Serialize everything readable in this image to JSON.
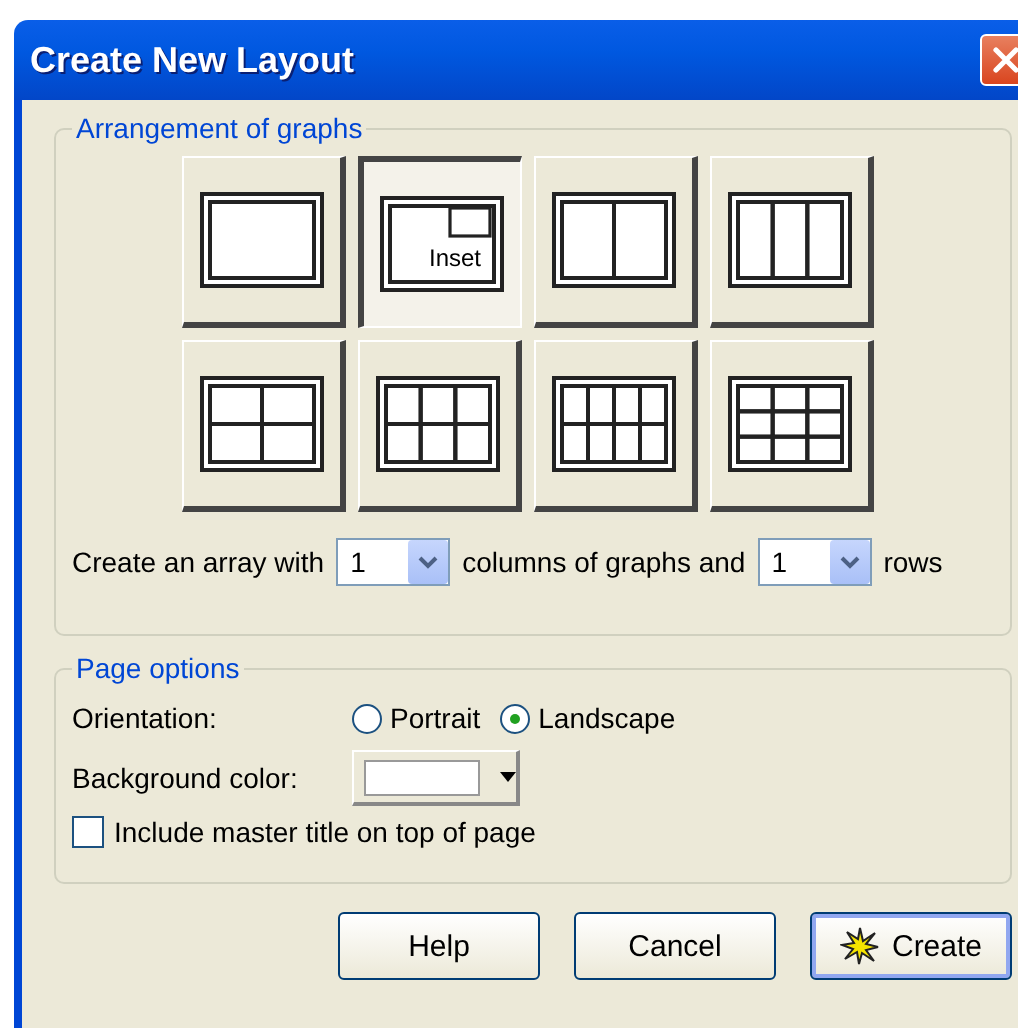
{
  "window": {
    "title": "Create New Layout"
  },
  "arrangement": {
    "legend": "Arrangement of graphs",
    "layouts": [
      {
        "kind": "one",
        "selected": false
      },
      {
        "kind": "inset",
        "label": "Inset",
        "selected": true
      },
      {
        "kind": "two-columns",
        "selected": false
      },
      {
        "kind": "three-columns",
        "selected": false
      },
      {
        "kind": "two-by-two",
        "selected": false
      },
      {
        "kind": "three-by-two",
        "selected": false
      },
      {
        "kind": "four-by-two",
        "selected": false
      },
      {
        "kind": "three-by-three",
        "selected": false
      }
    ],
    "array_row": {
      "prefix": "Create an array with",
      "columns_value": "1",
      "middle": "columns of graphs and",
      "rows_value": "1",
      "suffix": "rows"
    }
  },
  "page_options": {
    "legend": "Page options",
    "orientation": {
      "label": "Orientation:",
      "options": [
        {
          "label": "Portrait",
          "selected": false
        },
        {
          "label": "Landscape",
          "selected": true
        }
      ]
    },
    "background": {
      "label": "Background color:",
      "color": "#ffffff"
    },
    "master_title": {
      "label": "Include master title on top of page",
      "checked": false
    }
  },
  "buttons": [
    {
      "kind": "plain",
      "label": "Help"
    },
    {
      "kind": "plain",
      "label": "Cancel"
    },
    {
      "kind": "default",
      "label": "Create"
    }
  ]
}
